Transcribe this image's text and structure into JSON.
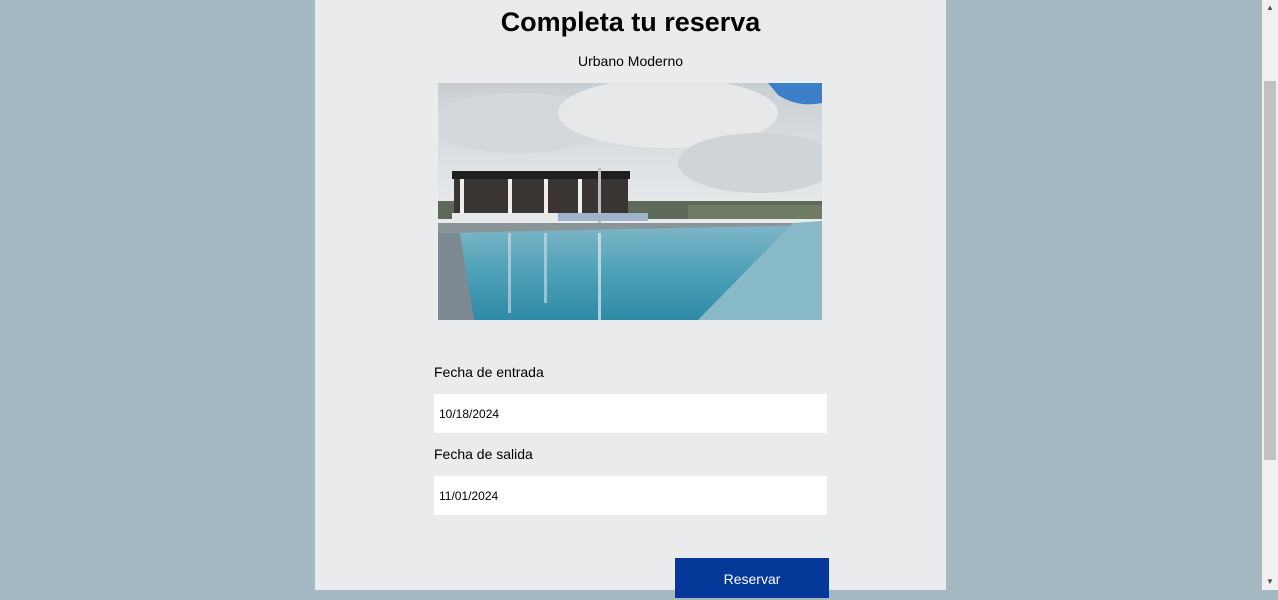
{
  "booking": {
    "title": "Completa tu reserva",
    "hotel_name": "Urbano Moderno",
    "image_description": "rooftop-pool-photo",
    "checkin_label": "Fecha de entrada",
    "checkin_value": "10/18/2024",
    "checkout_label": "Fecha de salida",
    "checkout_value": "11/01/2024",
    "submit_label": "Reservar"
  },
  "colors": {
    "background": "#a4b9c1",
    "panel": "#eaebed",
    "button": "#06389a"
  },
  "scrollbar": {
    "up_icon": "chevron-up-icon",
    "down_icon": "chevron-down-icon"
  }
}
